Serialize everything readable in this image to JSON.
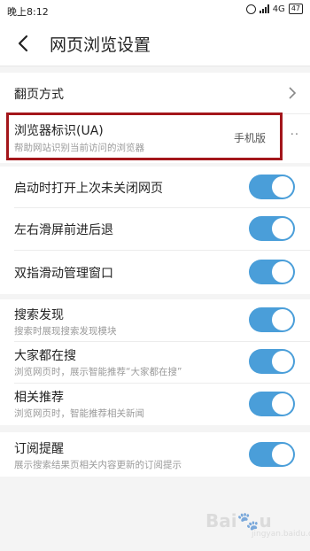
{
  "status_bar": {
    "time": "晚上8:12",
    "network": "4G",
    "battery": "47"
  },
  "header": {
    "title": "网页浏览设置",
    "back_icon": "chevron-left-icon"
  },
  "settings": {
    "page_turn": {
      "label": "翻页方式"
    },
    "user_agent": {
      "label": "浏览器标识(UA)",
      "description": "帮助网站识别当前访问的浏览器",
      "value": "手机版"
    },
    "restore_tabs": {
      "label": "启动时打开上次未关闭网页",
      "enabled": true
    },
    "swipe_nav": {
      "label": "左右滑屏前进后退",
      "enabled": true
    },
    "two_finger": {
      "label": "双指滑动管理窗口",
      "enabled": true
    },
    "search_discovery": {
      "label": "搜索发现",
      "description": "搜索时展现搜索发现模块",
      "enabled": true
    },
    "everyone_searching": {
      "label": "大家都在搜",
      "description": "浏览网页时，展示智能推荐“大家都在搜”",
      "enabled": true
    },
    "related_recs": {
      "label": "相关推荐",
      "description": "浏览网页时，智能推荐相关新闻",
      "enabled": true
    },
    "subscription_alert": {
      "label": "订阅提醒",
      "description": "展示搜索结果页相关内容更新的订阅提示",
      "enabled": true
    }
  },
  "colors": {
    "toggle_on": "#4a9ed9",
    "highlight": "#a3161b"
  }
}
